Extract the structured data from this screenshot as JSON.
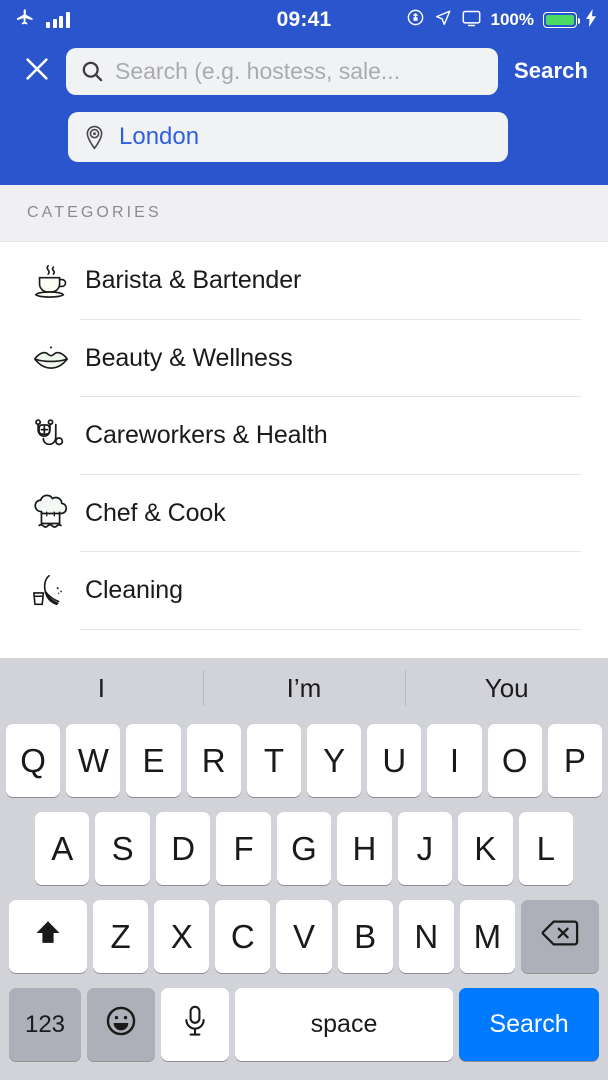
{
  "status_bar": {
    "airplane_icon": "airplane-icon",
    "signal_icon": "signal-bars-icon",
    "time": "09:41",
    "rotation_lock_icon": "rotation-lock-icon",
    "location_icon": "location-arrow-icon",
    "airplay_icon": "screen-mirroring-icon",
    "battery_percent": "100%",
    "battery_icon": "battery-icon",
    "charging_icon": "lightning-bolt-icon"
  },
  "header": {
    "background_color": "#2a55cc",
    "close_label": "close-icon",
    "search": {
      "placeholder": "Search (e.g. hostess, sale...",
      "value": "",
      "icon": "search-icon"
    },
    "search_action_label": "Search",
    "location": {
      "value": "London",
      "icon": "location-pin-icon",
      "text_color": "#2f5fe0"
    }
  },
  "categories": {
    "section_title": "CATEGORIES",
    "items": [
      {
        "label": "Barista & Bartender",
        "icon": "coffee-cup-icon"
      },
      {
        "label": "Beauty & Wellness",
        "icon": "lips-icon"
      },
      {
        "label": "Careworkers & Health",
        "icon": "stethoscope-icon"
      },
      {
        "label": "Chef & Cook",
        "icon": "chef-hat-icon"
      },
      {
        "label": "Cleaning",
        "icon": "bucket-brush-icon"
      }
    ]
  },
  "keyboard": {
    "predictions": [
      "I",
      "I’m",
      "You"
    ],
    "row1": [
      "Q",
      "W",
      "E",
      "R",
      "T",
      "Y",
      "U",
      "I",
      "O",
      "P"
    ],
    "row2": [
      "A",
      "S",
      "D",
      "F",
      "G",
      "H",
      "J",
      "K",
      "L"
    ],
    "row3": [
      "Z",
      "X",
      "C",
      "V",
      "B",
      "N",
      "M"
    ],
    "shift_icon": "shift-arrow-icon",
    "delete_icon": "backspace-icon",
    "numeric_label": "123",
    "emoji_icon": "smiley-face-icon",
    "dictation_icon": "microphone-icon",
    "space_label": "space",
    "return_label": "Search",
    "return_color": "#007aff",
    "background_color": "#d1d3d9"
  }
}
